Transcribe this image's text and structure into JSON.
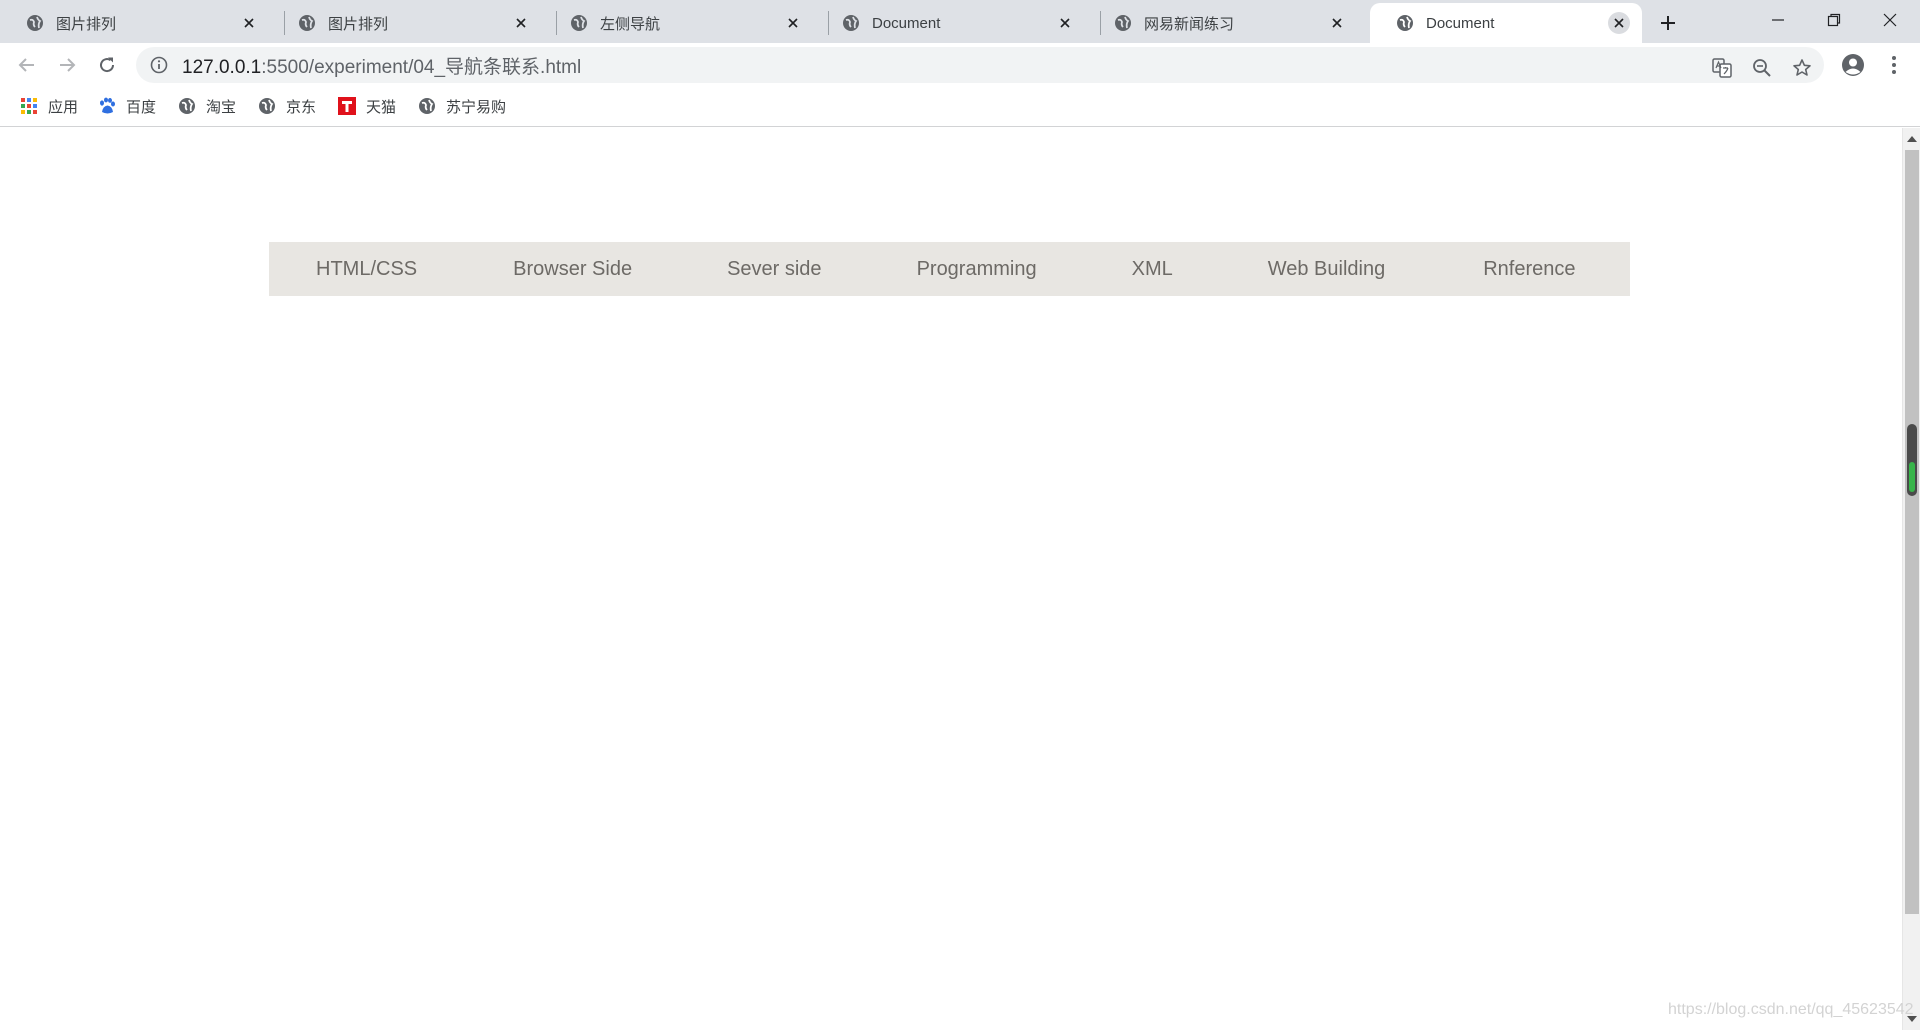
{
  "browser": {
    "tabs": [
      {
        "title": "图片排列",
        "active": false
      },
      {
        "title": "图片排列",
        "active": false
      },
      {
        "title": "左侧导航",
        "active": false
      },
      {
        "title": "Document",
        "active": false
      },
      {
        "title": "网易新闻练习",
        "active": false
      },
      {
        "title": "Document",
        "active": true
      }
    ],
    "address": {
      "host": "127.0.0.1",
      "path": ":5500/experiment/04_导航条联系.html"
    },
    "bookmarks": [
      {
        "label": "应用",
        "icon": "apps-grid-icon"
      },
      {
        "label": "百度",
        "icon": "baidu-paw-icon"
      },
      {
        "label": "淘宝",
        "icon": "globe-icon"
      },
      {
        "label": "京东",
        "icon": "globe-icon"
      },
      {
        "label": "天猫",
        "icon": "tmall-icon"
      },
      {
        "label": "苏宁易购",
        "icon": "globe-icon"
      }
    ]
  },
  "page": {
    "nav_items": [
      "HTML/CSS",
      "Browser Side",
      "Sever side",
      "Programming",
      "XML",
      "Web Building",
      "Rnference"
    ]
  },
  "watermark": "https://blog.csdn.net/qq_45623542",
  "colors": {
    "tabstrip_bg": "#dee1e6",
    "navbar_bg": "#e8e6e2",
    "nav_text": "#6d6a66",
    "scroll_grip_accent": "#38b54a"
  }
}
